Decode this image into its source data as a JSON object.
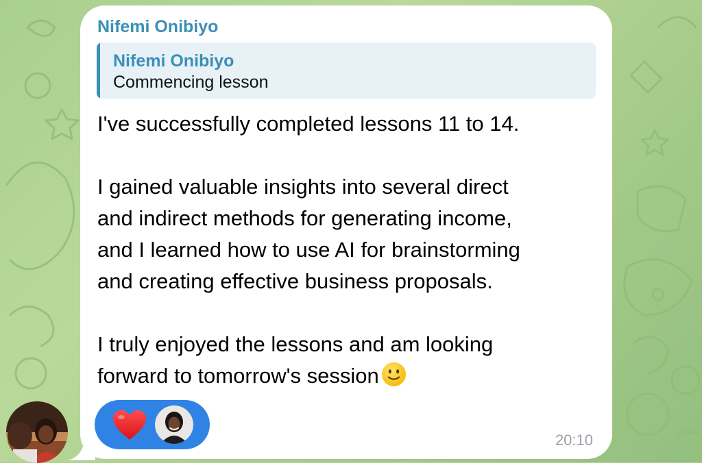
{
  "chat": {
    "wallpaper": "doodle-pattern",
    "accent_color": "#3a8fb7",
    "reaction_color": "#2f83e4"
  },
  "message": {
    "sender_name": "Nifemi Onibiyo",
    "reply": {
      "name": "Nifemi Onibiyo",
      "text": "Commencing lesson"
    },
    "paragraph_1": "I've successfully completed lessons 11 to 14.",
    "paragraph_2_line_1": "I gained valuable insights into several direct",
    "paragraph_2_line_2": "and indirect methods for generating income,",
    "paragraph_2_line_3": "and I learned how to use AI for brainstorming",
    "paragraph_2_line_4": "and creating effective business proposals.",
    "paragraph_3_line_1": "I truly enjoyed the lessons and am looking",
    "paragraph_3_line_2": "forward to tomorrow's session",
    "emoji": "slightly-smiling-face-icon",
    "time": "20:10"
  },
  "reaction": {
    "icon": "heart-icon",
    "reactor_avatar": "avatar"
  }
}
